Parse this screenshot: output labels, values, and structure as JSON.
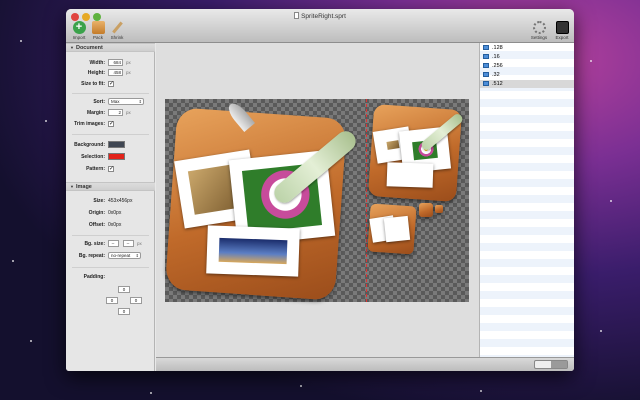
{
  "window": {
    "title": "SpriteRight.sprt"
  },
  "toolbar": {
    "import_label": "Import",
    "pack_label": "Pack",
    "shrink_label": "Shrink",
    "settings_label": "Settings",
    "export_label": "Export"
  },
  "document": {
    "header": "Document",
    "width_label": "Width:",
    "width_value": "684",
    "width_unit": "px",
    "height_label": "Height:",
    "height_value": "458",
    "height_unit": "px",
    "size_to_fit_label": "Size to fit:",
    "size_to_fit_checked": "✓",
    "sort_label": "Sort:",
    "sort_value": "Max",
    "margin_label": "Margin:",
    "margin_value": "2",
    "margin_unit": "px",
    "trim_label": "Trim images:",
    "trim_checked": "✓",
    "background_label": "Background:",
    "background_color": "#3f4652",
    "selection_label": "Selection:",
    "selection_color": "#e2231a",
    "pattern_label": "Pattern:",
    "pattern_checked": "✓"
  },
  "image": {
    "header": "Image",
    "size_label": "Size:",
    "size_value": "453x456px",
    "origin_label": "Origin:",
    "origin_value": "0x0px",
    "offset_label": "Offset:",
    "offset_value": "0x0px",
    "bg_size_label": "Bg. size:",
    "bg_size_w": "–",
    "bg_size_h": "–",
    "bg_size_unit": "px",
    "bg_repeat_label": "Bg. repeat:",
    "bg_repeat_value": "no-repeat",
    "padding_label": "Padding:",
    "padding_top": "0",
    "padding_left": "0",
    "padding_right": "0",
    "padding_bottom": "0"
  },
  "files": [
    ".128",
    ".16",
    ".256",
    ".32",
    ".512"
  ],
  "selected_file_index": 4
}
